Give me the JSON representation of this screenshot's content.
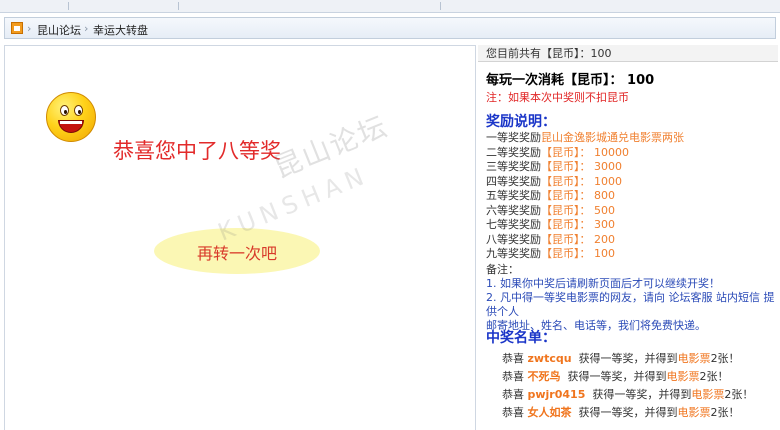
{
  "breadcrumb": {
    "home_icon": "home-icon",
    "sep1": "›",
    "forum": "昆山论坛",
    "sep2": "›",
    "current": "幸运大转盘"
  },
  "left": {
    "congrats": "恭喜您中了八等奖",
    "again_button": "再转一次吧",
    "watermark_cn": "昆山论坛",
    "watermark_en": "KUNSHAN"
  },
  "right": {
    "coins_line": "您目前共有【昆币】：100",
    "cost_line": "每玩一次消耗【昆币】： 100",
    "note": "注：如果本次中奖则不扣昆币",
    "prize_title": "奖励说明：",
    "prizes": [
      {
        "label": "一等奖奖励",
        "value": "昆山金逸影城通兑电影票两张"
      },
      {
        "label": "二等奖奖励",
        "value": "【昆币】： 10000"
      },
      {
        "label": "三等奖奖励",
        "value": "【昆币】： 3000"
      },
      {
        "label": "四等奖奖励",
        "value": "【昆币】： 1000"
      },
      {
        "label": "五等奖奖励",
        "value": "【昆币】： 800"
      },
      {
        "label": "六等奖奖励",
        "value": "【昆币】： 500"
      },
      {
        "label": "七等奖奖励",
        "value": "【昆币】： 300"
      },
      {
        "label": "八等奖奖励",
        "value": "【昆币】： 200"
      },
      {
        "label": "九等奖奖励",
        "value": "【昆币】： 100"
      }
    ],
    "remarks_head": "备注：",
    "remark1": "1. 如果你中奖后请刷新页面后才可以继续开奖！",
    "remark2a": "2. 凡中得一等奖电影票的网友，请向 论坛客服 站内短信 提供个人",
    "remark2b": "邮寄地址、姓名、电话等，我们将免费快递。",
    "winners_title": "中奖名单：",
    "winners": [
      {
        "prefix": "恭喜",
        "name": "zwtcqu",
        "mid": "获得一等奖，并得到",
        "movie": "电影票",
        "suffix": "2张！"
      },
      {
        "prefix": "恭喜",
        "name": "不死鸟",
        "mid": "获得一等奖，并得到",
        "movie": "电影票",
        "suffix": "2张！"
      },
      {
        "prefix": "恭喜",
        "name": "pwjr0415",
        "mid": "获得一等奖，并得到",
        "movie": "电影票",
        "suffix": "2张！"
      },
      {
        "prefix": "恭喜",
        "name": "女人如茶",
        "mid": "获得一等奖，并得到",
        "movie": "电影票",
        "suffix": "2张！"
      }
    ]
  }
}
